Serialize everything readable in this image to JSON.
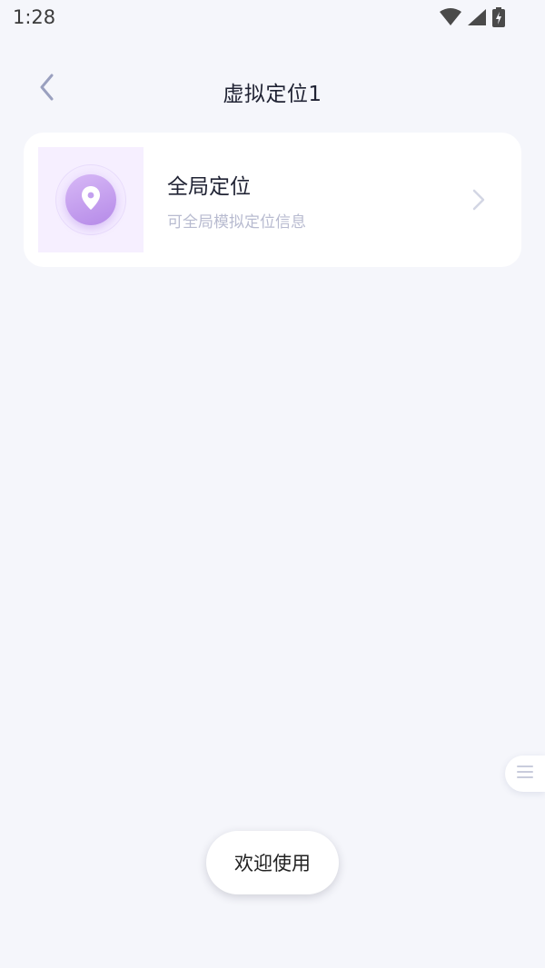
{
  "status_bar": {
    "time": "1:28",
    "icons": [
      "wifi-icon",
      "cell-signal-icon",
      "battery-charging-icon"
    ]
  },
  "header": {
    "back_icon": "chevron-left-icon",
    "title": "虚拟定位1"
  },
  "card": {
    "icon": "location-pin-icon",
    "title": "全局定位",
    "subtitle": "可全局模拟定位信息",
    "chevron_icon": "chevron-right-icon"
  },
  "side_handle": {
    "icon": "menu-lines-icon"
  },
  "toast": {
    "text": "欢迎使用"
  },
  "colors": {
    "background": "#f5f6fb",
    "card": "#ffffff",
    "accent_purple": "#b58ae8",
    "title_text": "#1f2233",
    "subtitle_text": "#b8bbd0"
  }
}
